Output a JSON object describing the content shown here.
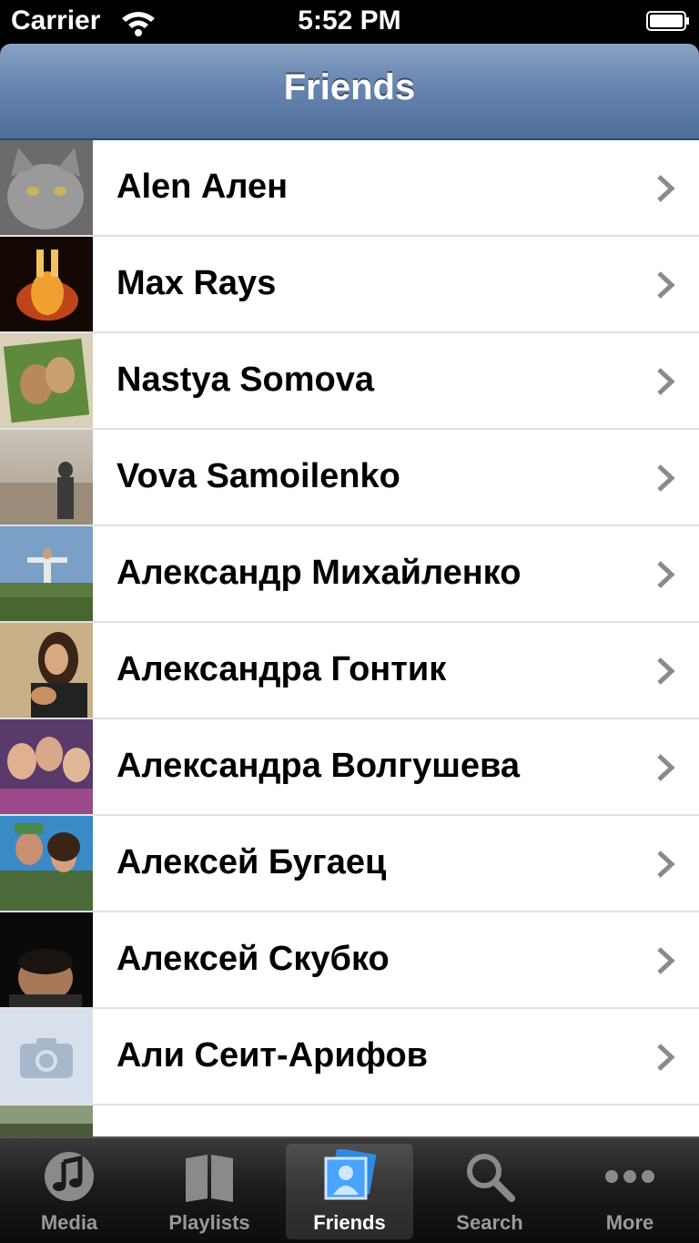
{
  "status_bar": {
    "carrier": "Carrier",
    "time": "5:52 PM"
  },
  "nav": {
    "title": "Friends"
  },
  "friends": [
    {
      "name": "Alen Ален"
    },
    {
      "name": "Max Rays"
    },
    {
      "name": "Nastya Somova"
    },
    {
      "name": "Vova Samoilenko"
    },
    {
      "name": "Александр Михайленко"
    },
    {
      "name": "Александра Гонтик"
    },
    {
      "name": "Александра Волгушева"
    },
    {
      "name": "Алексей Бугаец"
    },
    {
      "name": "Алексей Скубко"
    },
    {
      "name": "Али Сеит-Арифов"
    },
    {
      "name": ""
    }
  ],
  "tabs": [
    {
      "label": "Media",
      "icon": "music-note-icon"
    },
    {
      "label": "Playlists",
      "icon": "book-icon"
    },
    {
      "label": "Friends",
      "icon": "friends-photo-icon",
      "selected": true
    },
    {
      "label": "Search",
      "icon": "search-icon"
    },
    {
      "label": "More",
      "icon": "more-dots-icon"
    }
  ],
  "colors": {
    "nav_bar": "#5a7aa6",
    "tab_selected": "#4aa3ff"
  }
}
